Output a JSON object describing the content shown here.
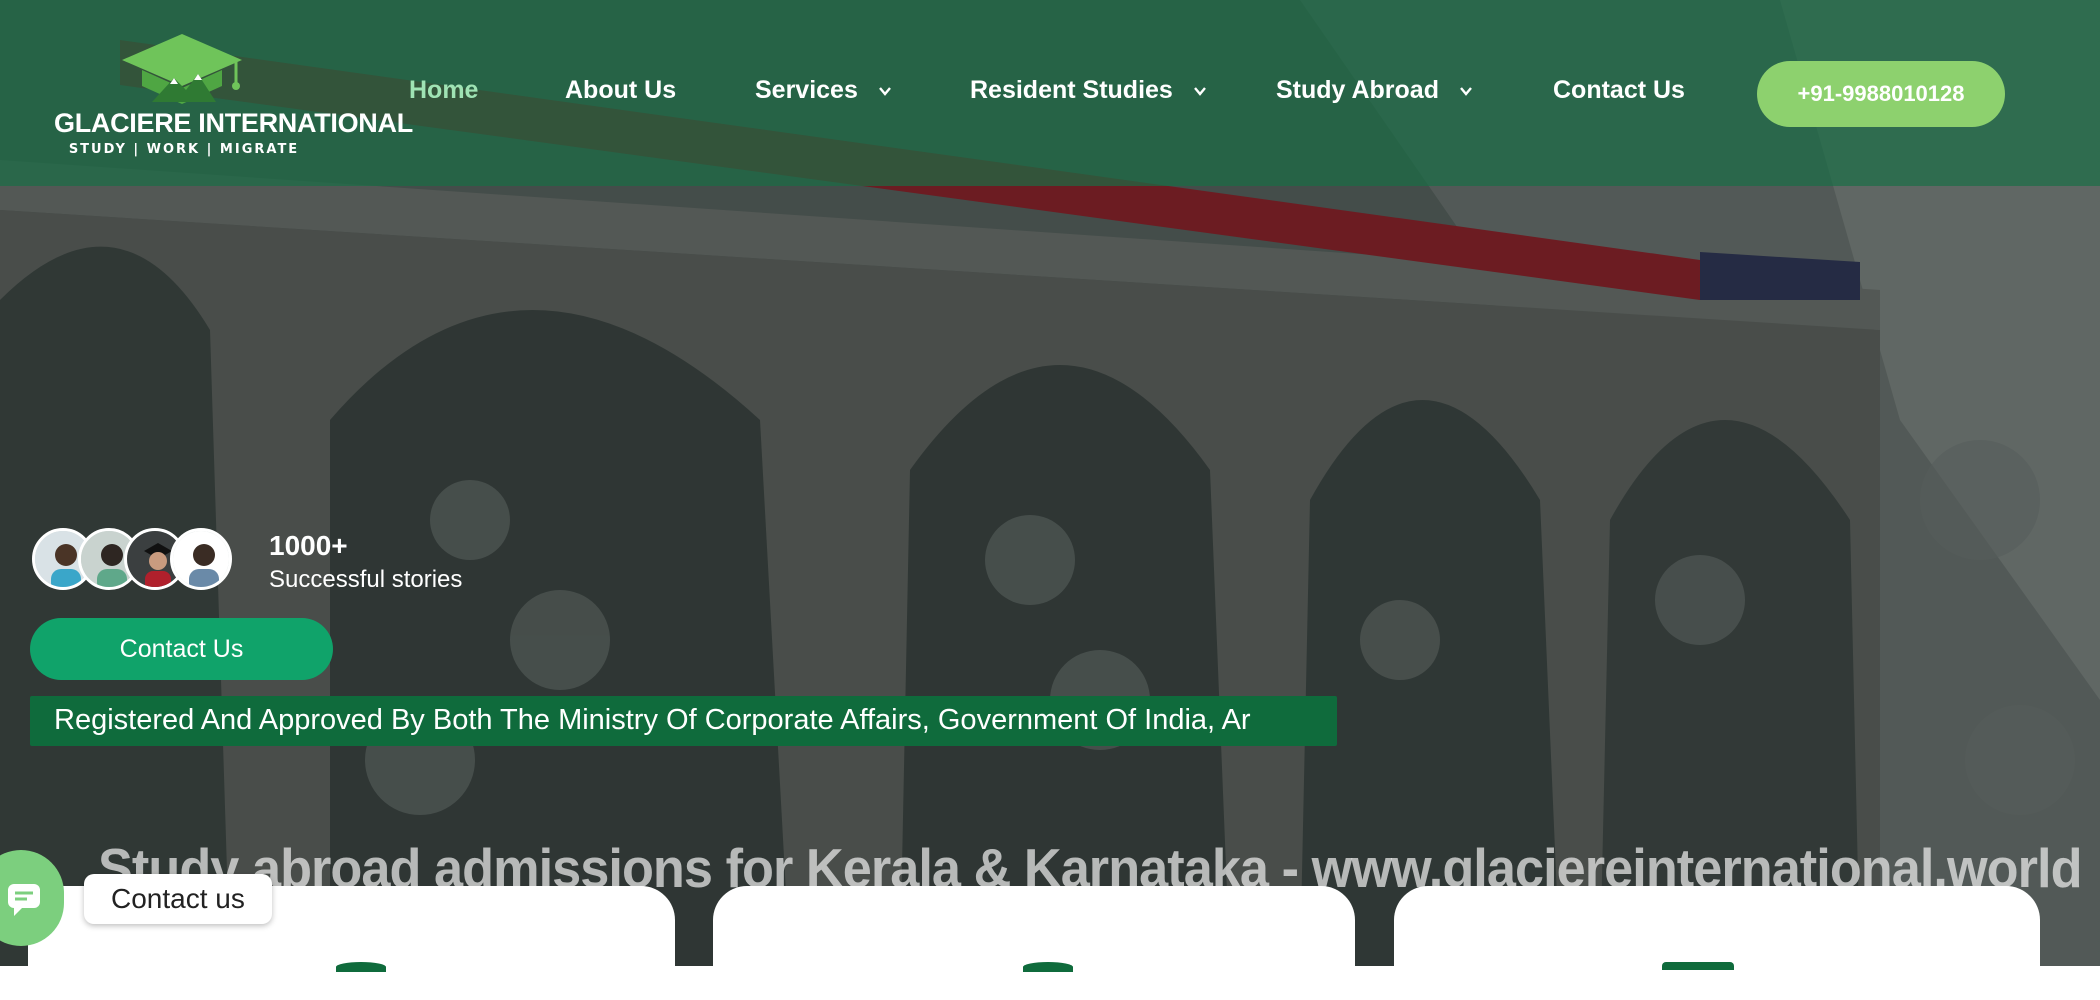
{
  "header": {
    "brand_name": "GLACIERE INTERNATIONAL",
    "brand_tagline": "STUDY | WORK | MIGRATE",
    "phone_button": "+91-9988010128"
  },
  "nav": {
    "items": [
      {
        "label": "Home",
        "active": true,
        "dropdown": false
      },
      {
        "label": "About Us",
        "active": false,
        "dropdown": false
      },
      {
        "label": "Services",
        "active": false,
        "dropdown": true
      },
      {
        "label": "Resident Studies",
        "active": false,
        "dropdown": true
      },
      {
        "label": "Study Abroad",
        "active": false,
        "dropdown": true
      },
      {
        "label": "Contact Us",
        "active": false,
        "dropdown": false
      }
    ]
  },
  "hero": {
    "stats_number": "1000+",
    "stats_label": "Successful stories",
    "contact_button": "Contact Us",
    "ticker_text": "Registered And Approved By Both The Ministry Of Corporate Affairs, Government Of India, Ar",
    "watermark_text": "Study abroad  admissions for Kerala & Karnataka - www.glaciereinternational.world"
  },
  "chat": {
    "label": "Contact us"
  },
  "colors": {
    "header_overlay": "#186e46",
    "accent_green": "#10a36a",
    "phone_button": "#8dd16e",
    "ticker_bg": "#0f6b3c",
    "active_nav": "#9fe3b4"
  },
  "icons": {
    "logo": "graduation-cap-mountain-icon",
    "dropdown": "chevron-down-icon",
    "chat": "chat-bubble-icon"
  }
}
